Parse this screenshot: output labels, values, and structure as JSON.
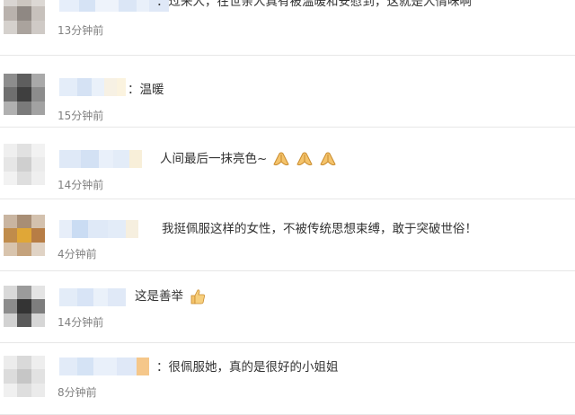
{
  "comments": [
    {
      "text": "：过来人，在世亲人真有被温暖和安慰到，这就是人情味啊",
      "time": "13分钟前",
      "emojis": [],
      "avatar_colors": [
        "#d9d5d2",
        "#ccc6c0",
        "#dcd8d4",
        "#b9b2ad",
        "#8f8883",
        "#c7c1bc",
        "#d5d1cd",
        "#aaa39d",
        "#cfcac6"
      ],
      "name_colors": [
        "#e6eefa",
        "#d6e3f5",
        "#eef3fb",
        "#dbe6f6",
        "#e9f0fa",
        "#dfe8f7"
      ]
    },
    {
      "text": "：温暖",
      "time": "15分钟前",
      "emojis": [],
      "avatar_colors": [
        "#8d8d8d",
        "#5e5e5e",
        "#a9a9a9",
        "#6f6f6f",
        "#3f3f3f",
        "#8c8c8c",
        "#b0b0b0",
        "#7a7a7a",
        "#a2a2a2"
      ],
      "name_colors": [
        "#e4edf9",
        "#d5e2f4",
        "#eaf1fa",
        "#f7f1e4",
        "#fbf3df"
      ]
    },
    {
      "text": "人间最后一抹亮色~",
      "time": "14分钟前",
      "emojis": [
        "hands-emoji",
        "hands-emoji",
        "hands-emoji"
      ],
      "avatar_colors": [
        "#efefef",
        "#e1e1e1",
        "#f2f2f2",
        "#e6e6e6",
        "#cfcfcf",
        "#ebebeb",
        "#f2f2f2",
        "#dedede",
        "#efefef"
      ],
      "name_colors": [
        "#dfe9f7",
        "#d3e1f4",
        "#e9f0fa",
        "#e3ecf8",
        "#f8efd9"
      ]
    },
    {
      "text": "我挺佩服这样的女性，不被传统思想束缚，敢于突破世俗！",
      "time": "4分钟前",
      "emojis": [],
      "avatar_colors": [
        "#c9b5a1",
        "#a88e75",
        "#d3c1ae",
        "#c08c4b",
        "#e0a737",
        "#b77d45",
        "#d8c4ad",
        "#c4a27c",
        "#e0d3c5"
      ],
      "name_colors": [
        "#e7eef9",
        "#cadcf3",
        "#dfe9f7",
        "#e3ecf8",
        "#f6efdf"
      ]
    },
    {
      "text": "这是善举",
      "time": "14分钟前",
      "emojis": [
        "thumbs-up-emoji"
      ],
      "avatar_colors": [
        "#d9d9d9",
        "#9b9b9b",
        "#e4e4e4",
        "#8c8c8c",
        "#343434",
        "#7d7d7d",
        "#d2d2d2",
        "#5a5a5a",
        "#d6d6d6"
      ],
      "name_colors": [
        "#e3ecf8",
        "#d8e4f6",
        "#eaf1fa",
        "#e0e9f7"
      ]
    },
    {
      "text": "：很佩服她，真的是很好的小姐姐",
      "time": "8分钟前",
      "emojis": [],
      "avatar_colors": [
        "#ececec",
        "#d9d9d9",
        "#eeeeee",
        "#dcdcdc",
        "#c6c6c6",
        "#e2e2e2",
        "#f0f0f0",
        "#dedede",
        "#ebebeb"
      ],
      "name_colors": [
        "#e2ebf8",
        "#d5e3f5",
        "#e9f0fa",
        "#dfe8f7",
        "#f5c78a"
      ]
    }
  ]
}
